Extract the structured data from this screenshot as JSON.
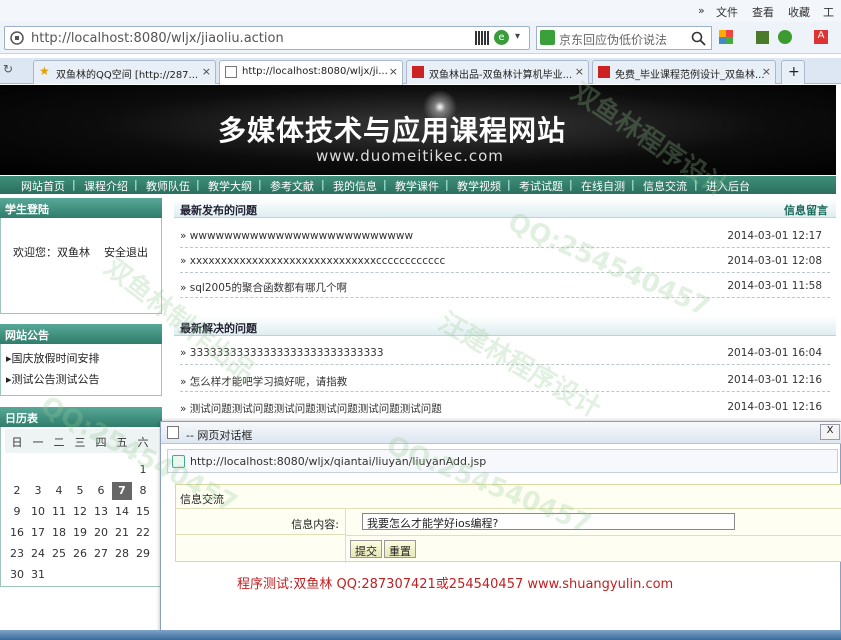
{
  "browser": {
    "menu": [
      "文件",
      "查看",
      "收藏",
      "工具"
    ],
    "menu_arrows": "»",
    "url": "http://localhost:8080/wljx/jiaoliu.action",
    "search_placeholder": "京东回应伪低价说法",
    "new_tab": "+",
    "tabs": [
      {
        "label": "双鱼林的QQ空间 [http://287...",
        "close": "×",
        "icon": "star-icon"
      },
      {
        "label": "http://localhost:8080/wljx/ji...",
        "close": "×",
        "icon": "page-icon",
        "active": true
      },
      {
        "label": "双鱼林出品-双鱼林计算机毕业...",
        "close": "×",
        "icon": "red-icon"
      },
      {
        "label": "免费_毕业课程范例设计_双鱼林...",
        "close": "×",
        "icon": "red-icon"
      }
    ]
  },
  "site": {
    "title": "多媒体技术与应用课程网站",
    "subtitle": "www.duomeitikec.com",
    "nav": [
      "网站首页",
      "课程介绍",
      "教师队伍",
      "教学大纲",
      "参考文献",
      "我的信息",
      "教学课件",
      "教学视频",
      "考试试题",
      "在线自测",
      "信息交流",
      "进入后台"
    ],
    "nav_sep": "|",
    "login": {
      "title": "学生登陆",
      "welcome": "欢迎您：双鱼林",
      "logout": "安全退出"
    },
    "notice": {
      "title": "网站公告",
      "items": [
        "国庆放假时间安排",
        "测试公告测试公告"
      ]
    },
    "calendar": {
      "title": "日历表",
      "weekdays": [
        "日",
        "一",
        "二",
        "三",
        "四",
        "五",
        "六"
      ],
      "days": [
        "1",
        "2",
        "3",
        "4",
        "5",
        "6",
        "7",
        "8",
        "9",
        "10",
        "11",
        "12",
        "13",
        "14",
        "15",
        "16",
        "17",
        "18",
        "19",
        "20",
        "21",
        "22",
        "23",
        "24",
        "25",
        "26",
        "27",
        "28",
        "29",
        "30",
        "31"
      ],
      "today": "7"
    },
    "latest": {
      "title": "最新发布的问题",
      "action": "信息留言",
      "items": [
        {
          "q": "wwwwwwwwwwwwwwwwwwwwwwwwww",
          "date": "2014-03-01 12:17"
        },
        {
          "q": "xxxxxxxxxxxxxxxxxxxxxxxxxxxxxxcccccccccccc",
          "date": "2014-03-01 12:08"
        },
        {
          "q": "sql2005的聚合函数都有哪几个啊",
          "date": "2014-03-01 11:58"
        }
      ]
    },
    "solved": {
      "title": "最新解决的问题",
      "items": [
        {
          "q": "33333333333333333333333333333",
          "date": "2014-03-01 16:04"
        },
        {
          "q": "怎么样才能吧学习搞好呢，请指教",
          "date": "2014-03-01 12:16"
        },
        {
          "q": "测试问题测试问题测试问题测试问题测试问题测试问题",
          "date": "2014-03-01 12:16"
        }
      ]
    },
    "bullet": "»"
  },
  "dialog": {
    "title": "-- 网页对话框",
    "close": "X",
    "url": "http://localhost:8080/wljx/qiantai/liuyan/liuyanAdd.jsp",
    "form_title": "信息交流",
    "label": "信息内容:",
    "value": "我要怎么才能学好ios编程?",
    "submit": "提交",
    "reset": "重置",
    "footer": "程序测试:双鱼林 QQ:287307421或254540457 www.shuangyulin.com"
  },
  "watermarks": [
    "QQ:254540457",
    "汪建林程序设计",
    "双鱼林制作出品",
    "QQ:254540457",
    "双鱼林程序设计",
    "QQ:254540457"
  ]
}
